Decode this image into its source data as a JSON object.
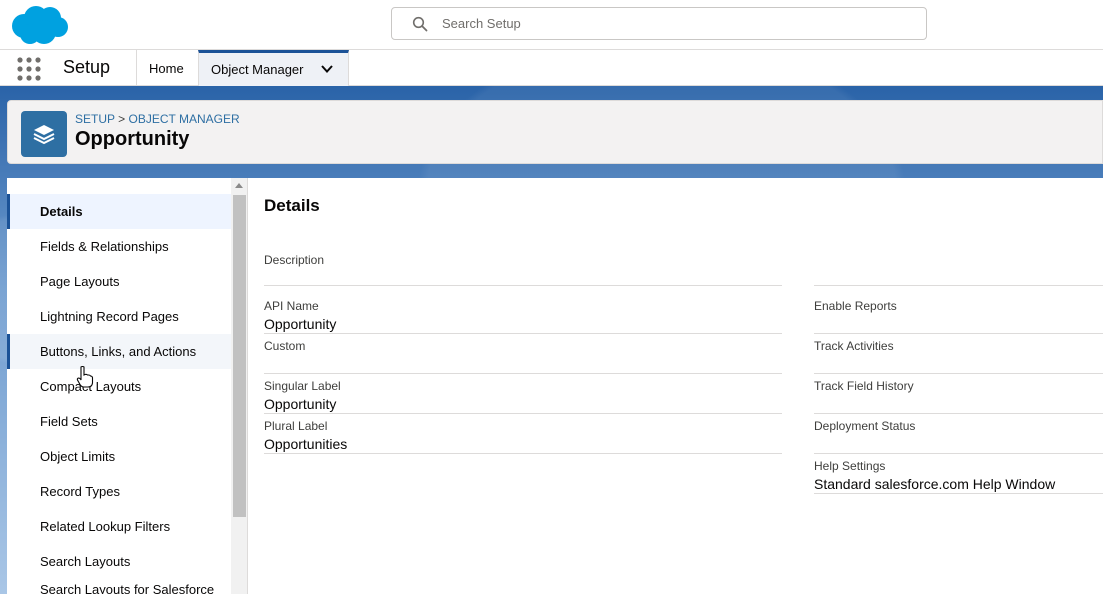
{
  "header": {
    "search_placeholder": "Search Setup"
  },
  "nav": {
    "app_name": "Setup",
    "tabs": [
      {
        "label": "Home"
      },
      {
        "label": "Object Manager"
      }
    ]
  },
  "page_header": {
    "breadcrumb": [
      "SETUP",
      "OBJECT MANAGER"
    ],
    "separator": ">",
    "title": "Opportunity"
  },
  "sidebar": {
    "items": [
      {
        "label": "Details"
      },
      {
        "label": "Fields & Relationships"
      },
      {
        "label": "Page Layouts"
      },
      {
        "label": "Lightning Record Pages"
      },
      {
        "label": "Buttons, Links, and Actions"
      },
      {
        "label": "Compact Layouts"
      },
      {
        "label": "Field Sets"
      },
      {
        "label": "Object Limits"
      },
      {
        "label": "Record Types"
      },
      {
        "label": "Related Lookup Filters"
      },
      {
        "label": "Search Layouts"
      },
      {
        "label": "Search Layouts for Salesforce Classic"
      }
    ]
  },
  "details": {
    "title": "Details",
    "description_label": "Description",
    "left_fields": [
      {
        "label": "API Name",
        "value": "Opportunity"
      },
      {
        "label": "Custom",
        "value": ""
      },
      {
        "label": "Singular Label",
        "value": "Opportunity"
      },
      {
        "label": "Plural Label",
        "value": "Opportunities"
      }
    ],
    "right_fields": [
      {
        "label": "Enable Reports",
        "value": ""
      },
      {
        "label": "Track Activities",
        "value": ""
      },
      {
        "label": "Track Field History",
        "value": ""
      },
      {
        "label": "Deployment Status",
        "value": ""
      },
      {
        "label": "Help Settings",
        "value": "Standard salesforce.com Help Window"
      }
    ]
  },
  "colors": {
    "brand_blue": "#1b5297",
    "logo_blue": "#00a1e0",
    "link_blue": "#2e6fa3"
  },
  "icons": {
    "logo": "salesforce-cloud-logo",
    "search": "search-icon",
    "waffle": "app-launcher-icon",
    "chevron": "chevron-down-icon",
    "object": "layers-icon"
  }
}
